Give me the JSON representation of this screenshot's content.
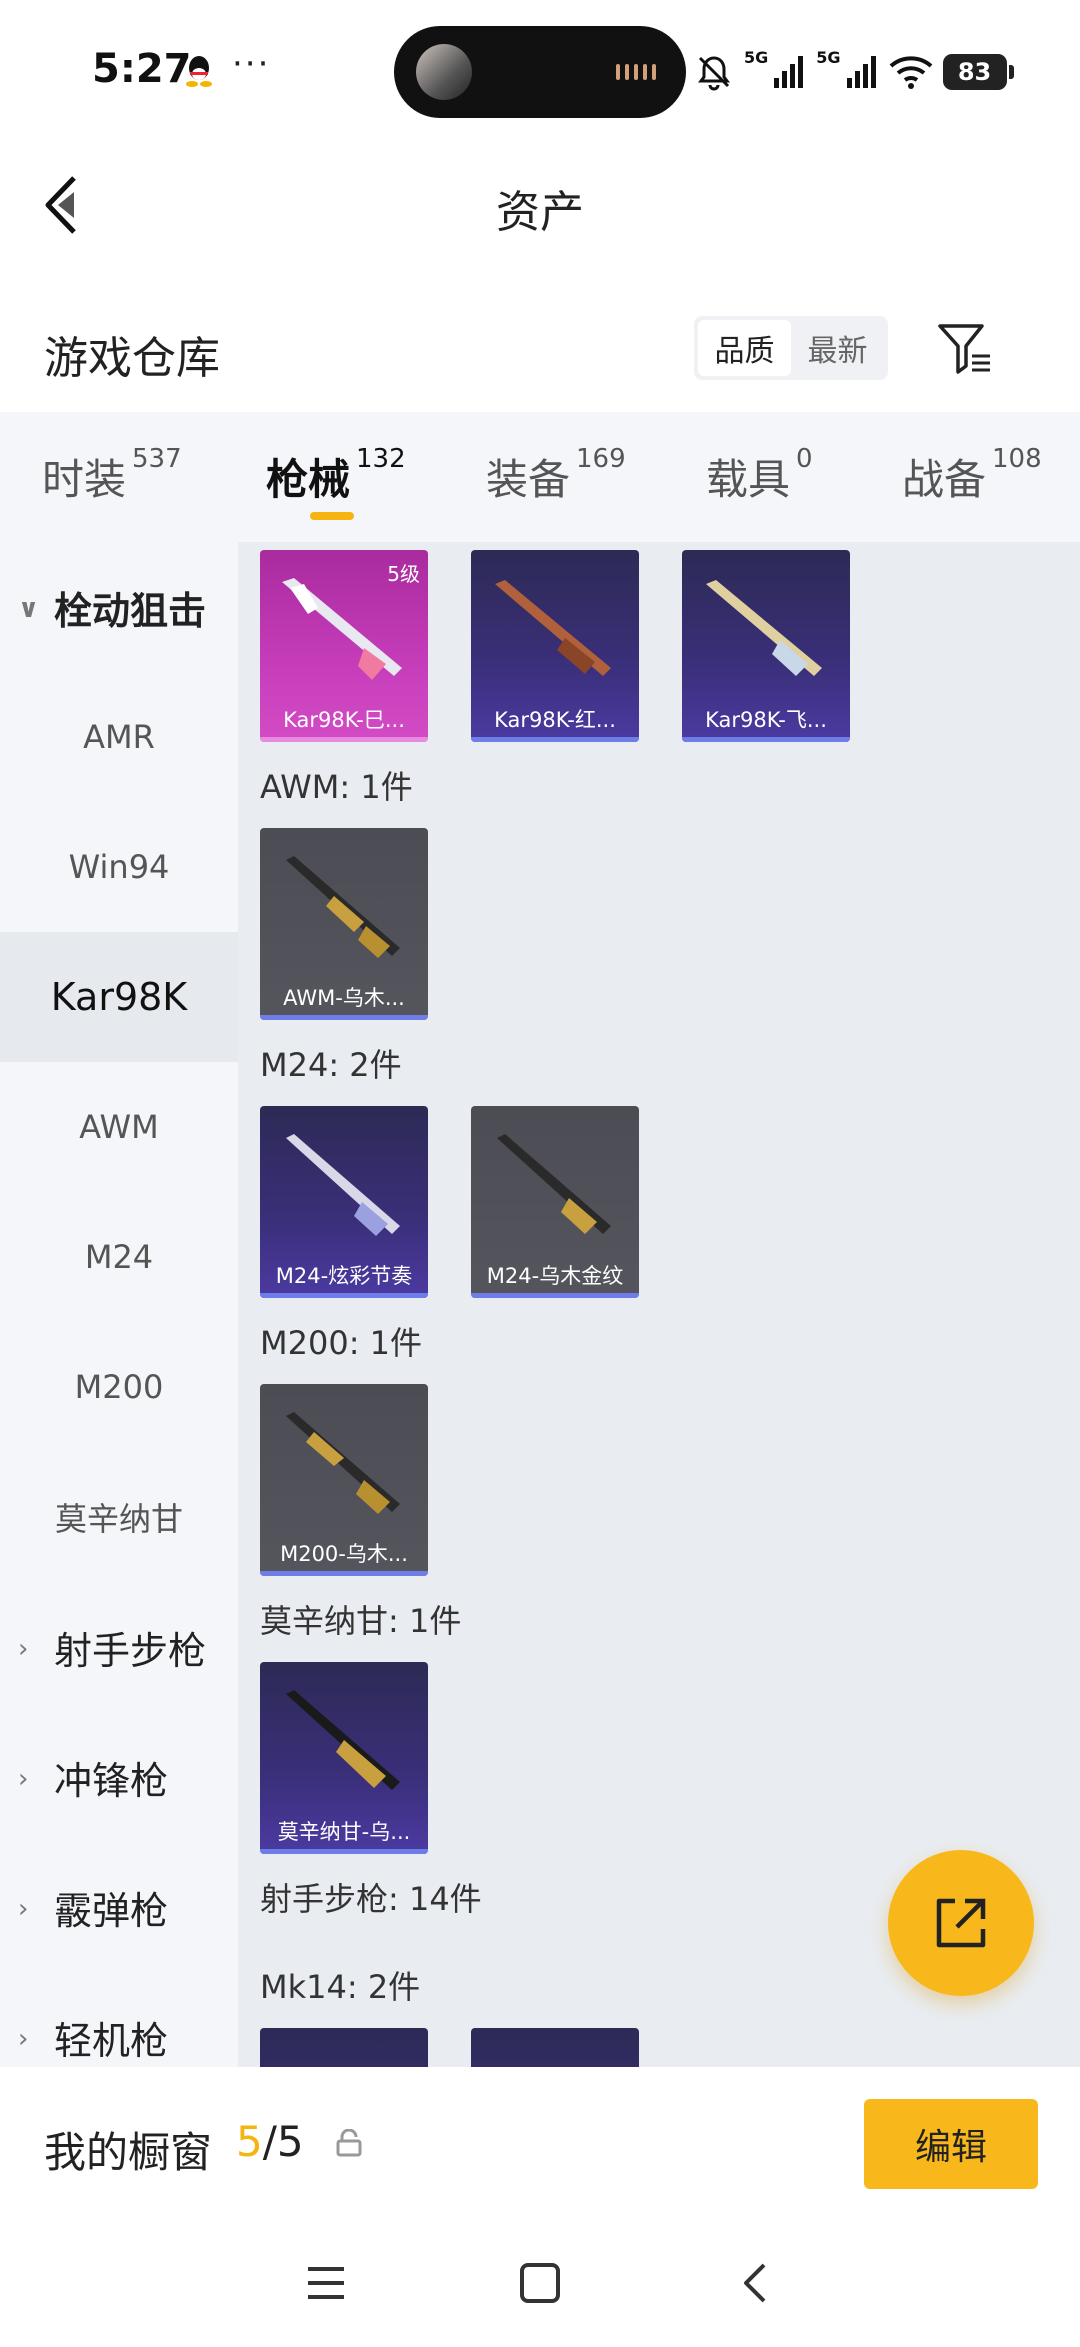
{
  "status_bar": {
    "time": "5:27",
    "more": "···",
    "signal1": "5G",
    "signal2": "5G",
    "battery": "83"
  },
  "header": {
    "title": "资产"
  },
  "section": {
    "title": "游戏仓库",
    "sort_options": [
      "品质",
      "最新"
    ]
  },
  "tabs": [
    {
      "label": "时装",
      "count": "537"
    },
    {
      "label": "枪械",
      "count": "132"
    },
    {
      "label": "装备",
      "count": "169"
    },
    {
      "label": "载具",
      "count": "0"
    },
    {
      "label": "战备",
      "count": "108"
    }
  ],
  "sidebar": {
    "items": [
      {
        "label": "栓动狙击",
        "type": "group",
        "expanded": true
      },
      {
        "label": "AMR"
      },
      {
        "label": "Win94"
      },
      {
        "label": "Kar98K",
        "active": true
      },
      {
        "label": "AWM"
      },
      {
        "label": "M24"
      },
      {
        "label": "M200"
      },
      {
        "label": "莫辛纳甘"
      },
      {
        "label": "射手步枪",
        "type": "group"
      },
      {
        "label": "冲锋枪",
        "type": "group"
      },
      {
        "label": "霰弹枪",
        "type": "group"
      },
      {
        "label": "轻机枪",
        "type": "group"
      }
    ]
  },
  "content": {
    "kar_cards": [
      {
        "name": "Kar98K-巳...",
        "level": "5级",
        "rarity": "pink"
      },
      {
        "name": "Kar98K-红...",
        "rarity": "purple"
      },
      {
        "name": "Kar98K-飞...",
        "rarity": "purple"
      }
    ],
    "groups": [
      {
        "label": "AWM: 1件",
        "cards": [
          {
            "name": "AWM-乌木...",
            "rarity": "gray"
          }
        ]
      },
      {
        "label": "M24: 2件",
        "cards": [
          {
            "name": "M24-炫彩节奏",
            "rarity": "purple"
          },
          {
            "name": "M24-乌木金纹",
            "rarity": "gray"
          }
        ]
      },
      {
        "label": "M200: 1件",
        "cards": [
          {
            "name": "M200-乌木...",
            "rarity": "gray"
          }
        ]
      },
      {
        "label": "莫辛纳甘: 1件",
        "cards": [
          {
            "name": "莫辛纳甘-乌...",
            "rarity": "purple"
          }
        ]
      }
    ],
    "category_label": "射手步枪: 14件",
    "mk14_label": "Mk14: 2件"
  },
  "bottom_bar": {
    "label": "我的橱窗",
    "count_current": "5",
    "count_total": "/5",
    "edit_label": "编辑"
  },
  "colors": {
    "accent": "#f8b81c",
    "purple_card": "#3a2f7a",
    "pink_card": "#c43bb8",
    "gray_card": "#505058"
  }
}
